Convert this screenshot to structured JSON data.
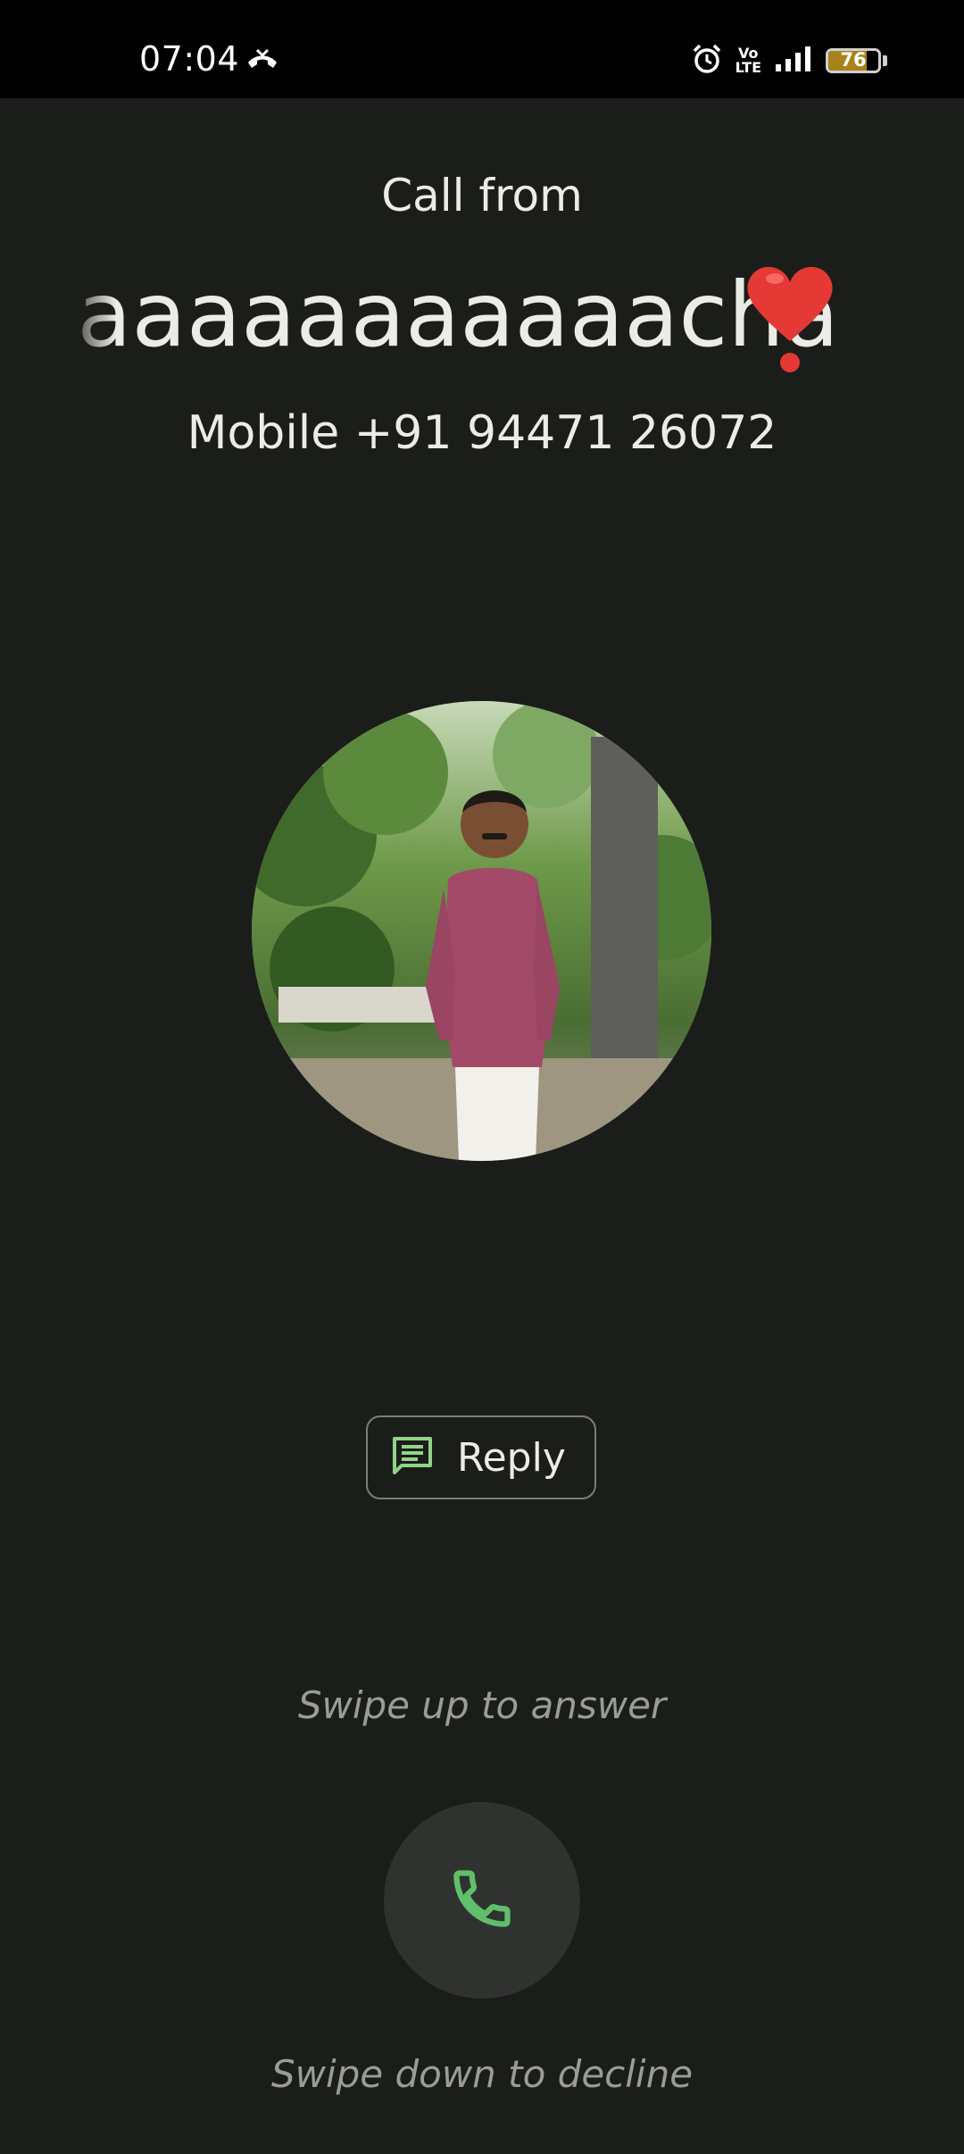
{
  "status_bar": {
    "time": "07:04",
    "call_icon": "incoming-call-icon",
    "alarm_icon": "alarm-icon",
    "volte_line1": "Vo",
    "volte_line2": "LTE",
    "signal_icon": "signal-icon",
    "battery_level": "76"
  },
  "call": {
    "header": "Call from",
    "caller_name": "aaaaaaaaaaacha",
    "caller_emoji": "❤️",
    "caller_number": "Mobile +91 94471 26072",
    "avatar_icon": "contact-photo"
  },
  "actions": {
    "reply_label": "Reply",
    "reply_icon": "message-icon",
    "swipe_up_hint": "Swipe up to answer",
    "answer_icon": "phone-icon",
    "swipe_down_hint": "Swipe down to decline"
  },
  "colors": {
    "background": "#1b1d1a",
    "accent_green": "#5fbf6b",
    "heart_red": "#e53935"
  }
}
